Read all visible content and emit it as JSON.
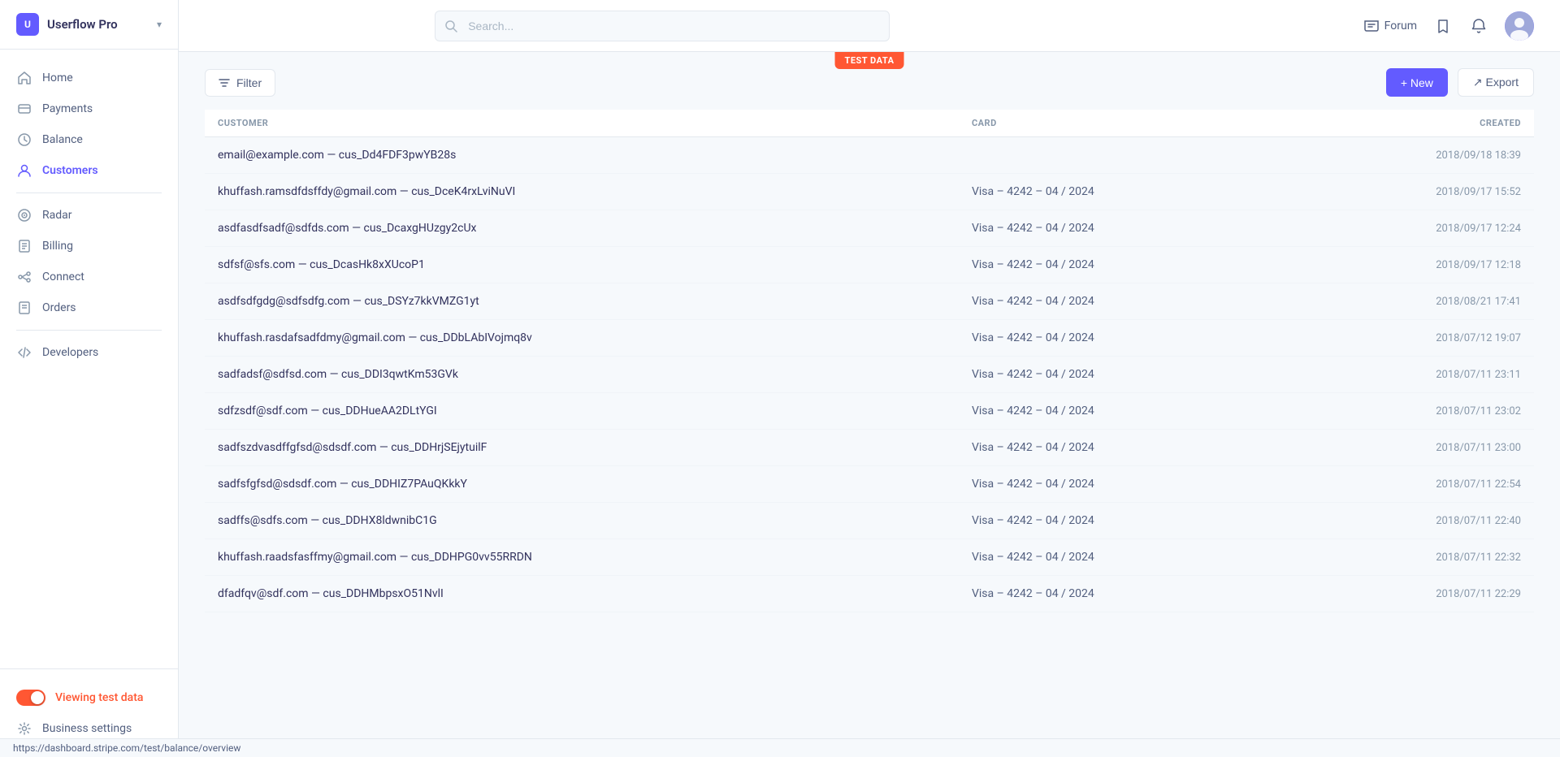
{
  "app": {
    "brand": "Userflow Pro",
    "chevron": "▾"
  },
  "header": {
    "search_placeholder": "Search...",
    "forum_label": "Forum"
  },
  "test_data_banner": "TEST DATA",
  "sidebar": {
    "items": [
      {
        "id": "home",
        "label": "Home",
        "icon": "home"
      },
      {
        "id": "payments",
        "label": "Payments",
        "icon": "payments"
      },
      {
        "id": "balance",
        "label": "Balance",
        "icon": "balance"
      },
      {
        "id": "customers",
        "label": "Customers",
        "icon": "customers",
        "active": true
      },
      {
        "id": "radar",
        "label": "Radar",
        "icon": "radar"
      },
      {
        "id": "billing",
        "label": "Billing",
        "icon": "billing"
      },
      {
        "id": "connect",
        "label": "Connect",
        "icon": "connect"
      },
      {
        "id": "orders",
        "label": "Orders",
        "icon": "orders"
      },
      {
        "id": "developers",
        "label": "Developers",
        "icon": "developers"
      }
    ],
    "test_data_label": "Viewing test data",
    "business_settings_label": "Business settings"
  },
  "toolbar": {
    "filter_label": "Filter",
    "new_label": "+ New",
    "export_label": "↗ Export"
  },
  "table": {
    "columns": [
      {
        "id": "customer",
        "label": "CUSTOMER"
      },
      {
        "id": "card",
        "label": "CARD"
      },
      {
        "id": "created",
        "label": "CREATED"
      }
    ],
    "rows": [
      {
        "customer": "email@example.com — cus_Dd4FDF3pwYB28s",
        "card": "",
        "created": "2018/09/18 18:39"
      },
      {
        "customer": "khuffash.ramsdfdsffdy@gmail.com — cus_DceK4rxLviNuVI",
        "card": "Visa – 4242 – 04 / 2024",
        "created": "2018/09/17 15:52"
      },
      {
        "customer": "asdfasdfsadf@sdfds.com — cus_DcaxgHUzgy2cUx",
        "card": "Visa – 4242 – 04 / 2024",
        "created": "2018/09/17 12:24"
      },
      {
        "customer": "sdfsf@sfs.com — cus_DcasHk8xXUcoP1",
        "card": "Visa – 4242 – 04 / 2024",
        "created": "2018/09/17 12:18"
      },
      {
        "customer": "asdfsdfgdg@sdfsdfg.com — cus_DSYz7kkVMZG1yt",
        "card": "Visa – 4242 – 04 / 2024",
        "created": "2018/08/21 17:41"
      },
      {
        "customer": "khuffash.rasdafsadfdmy@gmail.com — cus_DDbLAbIVojmq8v",
        "card": "Visa – 4242 – 04 / 2024",
        "created": "2018/07/12 19:07"
      },
      {
        "customer": "sadfadsf@sdfsd.com — cus_DDI3qwtKm53GVk",
        "card": "Visa – 4242 – 04 / 2024",
        "created": "2018/07/11 23:11"
      },
      {
        "customer": "sdfzsdf@sdf.com — cus_DDHueAA2DLtYGI",
        "card": "Visa – 4242 – 04 / 2024",
        "created": "2018/07/11 23:02"
      },
      {
        "customer": "sadfszdvasdffgfsd@sdsdf.com — cus_DDHrjSEjytuilF",
        "card": "Visa – 4242 – 04 / 2024",
        "created": "2018/07/11 23:00"
      },
      {
        "customer": "sadfsfgfsd@sdsdf.com — cus_DDHIZ7PAuQKkkY",
        "card": "Visa – 4242 – 04 / 2024",
        "created": "2018/07/11 22:54"
      },
      {
        "customer": "sadffs@sdfs.com — cus_DDHX8ldwnibC1G",
        "card": "Visa – 4242 – 04 / 2024",
        "created": "2018/07/11 22:40"
      },
      {
        "customer": "khuffash.raadsfasffmy@gmail.com — cus_DDHPG0vv55RRDN",
        "card": "Visa – 4242 – 04 / 2024",
        "created": "2018/07/11 22:32"
      },
      {
        "customer": "dfadfqv@sdf.com — cus_DDHMbpsxO51NvlI",
        "card": "Visa – 4242 – 04 / 2024",
        "created": "2018/07/11 22:29"
      }
    ]
  },
  "status_bar": {
    "url": "https://dashboard.stripe.com/test/balance/overview"
  }
}
